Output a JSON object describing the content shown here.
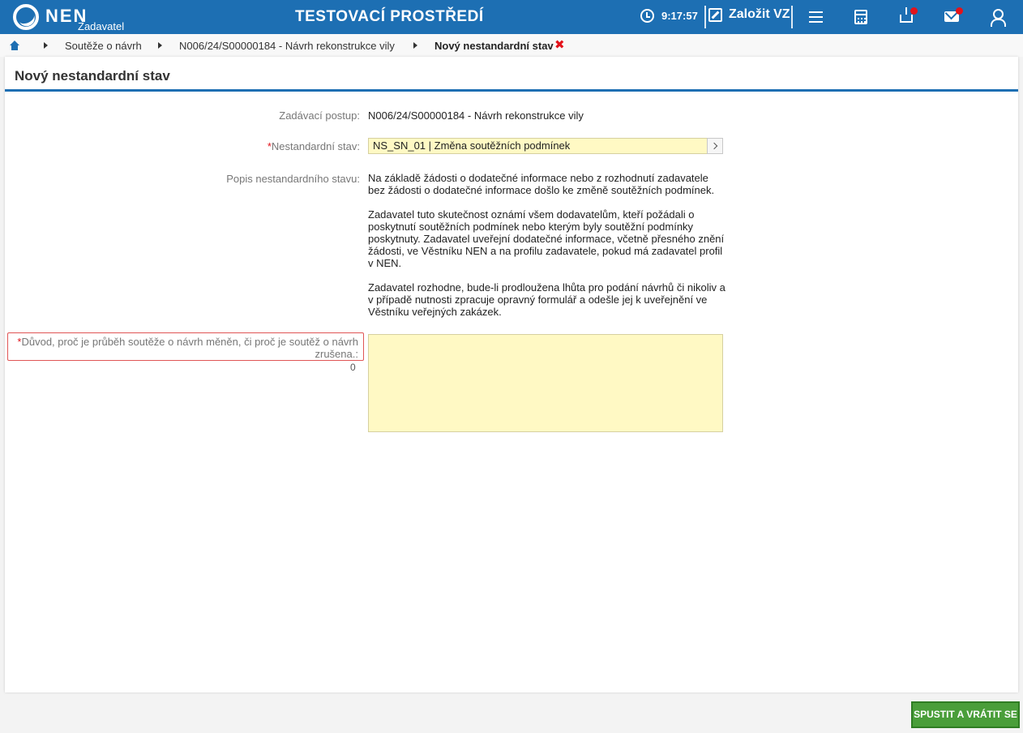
{
  "header": {
    "logo_text": "NEN",
    "logo_sub": "Zadavatel",
    "env_title": "TESTOVACÍ PROSTŘEDÍ",
    "clock": "9:17:57",
    "create_label": "Založit VZ",
    "icons": [
      "menu-icon",
      "calculator-icon",
      "inbox-icon",
      "mail-icon",
      "user-icon"
    ],
    "accent": "#1d6fb3"
  },
  "breadcrumb": {
    "items": [
      "Soutěže o návrh",
      "N006/24/S00000184 - Návrh rekonstrukce vily",
      "Nový nestandardní stav"
    ],
    "close_glyph": "✖"
  },
  "page": {
    "title": "Nový nestandardní stav"
  },
  "form": {
    "procedure_label": "Zadávací postup:",
    "procedure_value": "N006/24/S00000184 - Návrh rekonstrukce vily",
    "req_mark": "*",
    "state_label": "Nestandardní stav:",
    "state_value": "NS_SN_01 | Změna soutěžních podmínek",
    "description_label": "Popis nestandardního stavu:",
    "description": [
      "Na základě žádosti o dodatečné informace nebo z rozhodnutí zadavatele bez žádosti o dodatečné informace došlo ke změně soutěžních podmínek.",
      "Zadavatel tuto skutečnost oznámí všem dodavatelům, kteří požádali o poskytnutí soutěžních podmínek nebo kterým byly soutěžní podmínky poskytnuty. Zadavatel uveřejní dodatečné informace, včetně přesného znění žádosti, ve Věstníku NEN a na profilu zadavatele, pokud má zadavatel profil v NEN.",
      "Zadavatel rozhodne, bude-li prodloužena lhůta pro podání návrhů či nikoliv a v případě nutnosti zpracuje opravný formulář a odešle jej k uveřejnění ve Věstníku veřejných zakázek."
    ],
    "reason_label": "Důvod, proč je průběh soutěže o návrh měněn, či proč je soutěž o návrh zrušena.",
    "reason_colon": ":",
    "reason_value": "",
    "reason_counter": "0"
  },
  "actions": {
    "submit_label": "SPUSTIT A VRÁTIT SE"
  }
}
